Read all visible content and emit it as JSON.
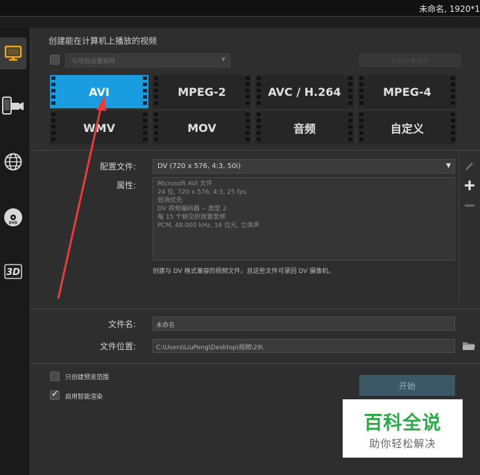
{
  "window": {
    "title": "未命名, 1920*1"
  },
  "sidebar": {
    "items": [
      {
        "name": "computer",
        "icon": "monitor-icon",
        "active": true
      },
      {
        "name": "device",
        "icon": "mobile-device-icon",
        "active": false
      },
      {
        "name": "web",
        "icon": "globe-icon",
        "active": false
      },
      {
        "name": "disc",
        "icon": "dvd-disc-icon",
        "active": false
      },
      {
        "name": "3d",
        "icon": "3d-icon",
        "label": "3D",
        "active": false
      }
    ]
  },
  "header": {
    "title": "创建能在计算机上播放的视频",
    "project_setting_label": "与项目设置相同",
    "disabled_button_label": "转到分享向导"
  },
  "formats": [
    {
      "label": "AVI",
      "selected": true
    },
    {
      "label": "MPEG-2",
      "selected": false
    },
    {
      "label": "AVC / H.264",
      "selected": false
    },
    {
      "label": "MPEG-4",
      "selected": false
    },
    {
      "label": "WMV",
      "selected": false
    },
    {
      "label": "MOV",
      "selected": false
    },
    {
      "label": "音频",
      "selected": false
    },
    {
      "label": "自定义",
      "selected": false
    }
  ],
  "profile": {
    "label": "配置文件:",
    "value": "DV (720 x 576, 4:3, 50i)"
  },
  "properties": {
    "label": "属性:",
    "lines": [
      "Microsoft AVI 文件",
      "24 位, 720 x 576, 4:3, 25 fps",
      "低场优先",
      "DV 视频编码器 -- 类型 2",
      "每 15 个帧交织放置音频",
      "PCM, 48.000 kHz, 16 位元, 立体声"
    ]
  },
  "note": "创建与 DV 格式兼容的视频文件。且这些文件可录回 DV 摄像机。",
  "file": {
    "name_label": "文件名:",
    "name_value": "未命名",
    "location_label": "文件位置:",
    "location_value": "C:\\Users\\LiuPeng\\Desktop\\视频\\29\\"
  },
  "options": {
    "preview_range_label": "只创建预览范围",
    "preview_range_checked": false,
    "smart_render_label": "启用智能渲染",
    "smart_render_checked": true
  },
  "start_button_label": "开始",
  "watermark": {
    "main": "百科全说",
    "sub": "助你轻松解决"
  },
  "colors": {
    "accent": "#1a9de0",
    "annotation_arrow": "#e83b3b",
    "watermark_green": "#2fa84a"
  }
}
